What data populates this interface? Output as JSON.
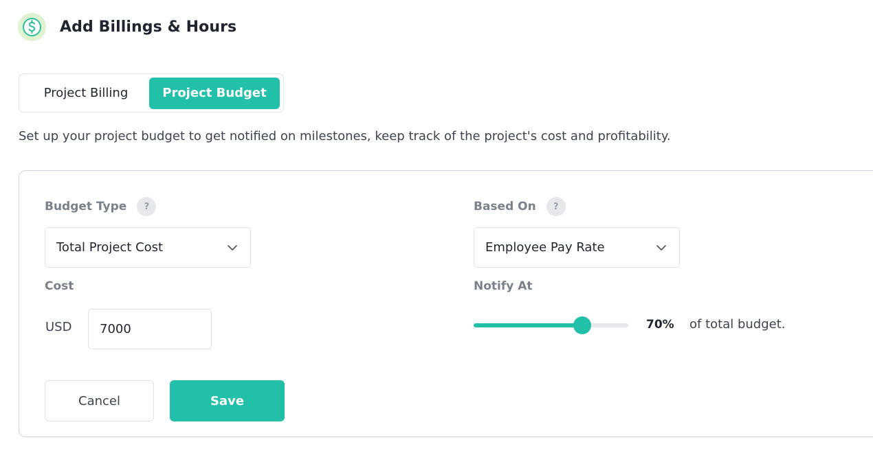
{
  "header": {
    "title": "Add Billings & Hours",
    "icon": "dollar-circle-icon",
    "icon_color": "#2bbf9f"
  },
  "tabs": [
    {
      "label": "Project Billing",
      "active": false
    },
    {
      "label": "Project Budget",
      "active": true
    }
  ],
  "description": "Set up your project budget to get notified on milestones, keep track of the project's cost and profitability.",
  "budget": {
    "budget_type_label": "Budget Type",
    "budget_type_value": "Total Project Cost",
    "based_on_label": "Based On",
    "based_on_value": "Employee Pay Rate",
    "help_glyph": "?",
    "cost_label": "Cost",
    "currency": "USD",
    "cost_value": "7000",
    "notify_label": "Notify At",
    "notify_percent": 70,
    "notify_percent_text": "70%",
    "notify_suffix": "of total budget."
  },
  "actions": {
    "cancel_label": "Cancel",
    "save_label": "Save"
  },
  "colors": {
    "accent": "#22bfa9",
    "icon_bg": "#dff2d2"
  }
}
